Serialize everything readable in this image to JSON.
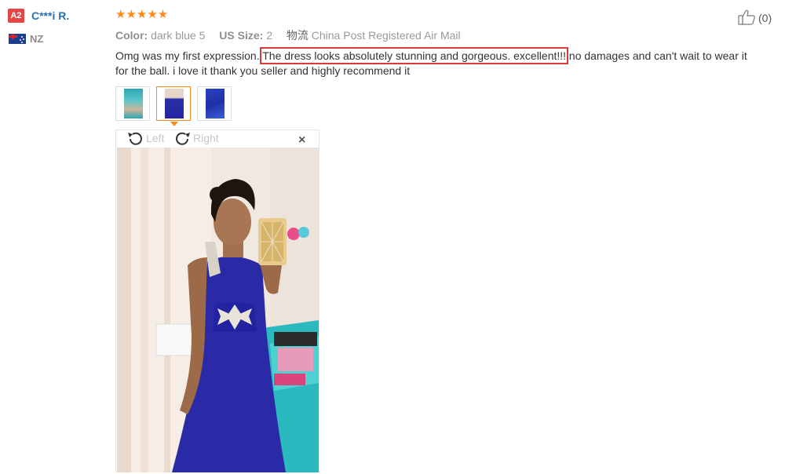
{
  "user": {
    "level_badge": "A2",
    "name": "C***i R.",
    "country": "NZ"
  },
  "review": {
    "rating": 5,
    "stars": "★★★★★",
    "meta": {
      "color_label": "Color:",
      "color_value": "dark blue 5",
      "size_label": "US Size:",
      "size_value": "2",
      "shipping_label": "物流",
      "shipping_value": "China Post Registered Air Mail"
    },
    "text_before": "Omg was my first expression. ",
    "text_highlight": "The dress looks absolutely stunning and gorgeous. excellent!!!",
    "text_after": " no damages and can't wait to wear it for the ball. i love it thank you seller and highly recommend it",
    "helpful_count": "(0)"
  },
  "viewer": {
    "rotate_left_label": "Left",
    "rotate_right_label": "Right",
    "close_symbol": "×",
    "selected_thumb": 2
  },
  "colors": {
    "accent": "#ff8a1a",
    "link": "#2a6fb0",
    "highlight_border": "#d93a3a",
    "badge": "#e64545"
  }
}
